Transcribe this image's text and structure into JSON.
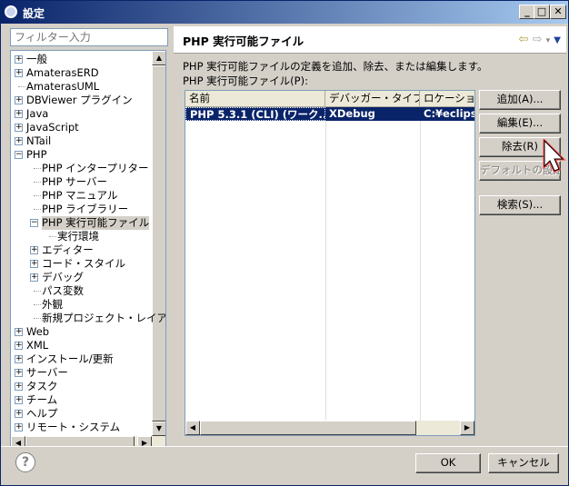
{
  "window": {
    "title": "設定"
  },
  "filter": {
    "placeholder": "フィルター入力"
  },
  "tree": {
    "items": [
      {
        "label": "一般",
        "level": 0,
        "expander": "+"
      },
      {
        "label": "AmaterasERD",
        "level": 0,
        "expander": "+"
      },
      {
        "label": "AmaterasUML",
        "level": 0,
        "expander": ""
      },
      {
        "label": "DBViewer プラグイン",
        "level": 0,
        "expander": "+"
      },
      {
        "label": "Java",
        "level": 0,
        "expander": "+"
      },
      {
        "label": "JavaScript",
        "level": 0,
        "expander": "+"
      },
      {
        "label": "NTail",
        "level": 0,
        "expander": "+"
      },
      {
        "label": "PHP",
        "level": 0,
        "expander": "-"
      },
      {
        "label": "PHP インタープリター",
        "level": 1,
        "expander": ""
      },
      {
        "label": "PHP サーバー",
        "level": 1,
        "expander": ""
      },
      {
        "label": "PHP マニュアル",
        "level": 1,
        "expander": ""
      },
      {
        "label": "PHP ライブラリー",
        "level": 1,
        "expander": ""
      },
      {
        "label": "PHP 実行可能ファイル",
        "level": 1,
        "expander": "-",
        "selected": true
      },
      {
        "label": "実行環境",
        "level": 2,
        "expander": ""
      },
      {
        "label": "エディター",
        "level": 1,
        "expander": "+"
      },
      {
        "label": "コード・スタイル",
        "level": 1,
        "expander": "+"
      },
      {
        "label": "デバッグ",
        "level": 1,
        "expander": "+"
      },
      {
        "label": "パス変数",
        "level": 1,
        "expander": ""
      },
      {
        "label": "外観",
        "level": 1,
        "expander": ""
      },
      {
        "label": "新規プロジェクト・レイア",
        "level": 1,
        "expander": ""
      },
      {
        "label": "Web",
        "level": 0,
        "expander": "+"
      },
      {
        "label": "XML",
        "level": 0,
        "expander": "+"
      },
      {
        "label": "インストール/更新",
        "level": 0,
        "expander": "+"
      },
      {
        "label": "サーバー",
        "level": 0,
        "expander": "+"
      },
      {
        "label": "タスク",
        "level": 0,
        "expander": "+"
      },
      {
        "label": "チーム",
        "level": 0,
        "expander": "+"
      },
      {
        "label": "ヘルプ",
        "level": 0,
        "expander": "+"
      },
      {
        "label": "リモート・システム",
        "level": 0,
        "expander": "+"
      }
    ]
  },
  "page": {
    "title": "PHP 実行可能ファイル",
    "description": "PHP 実行可能ファイルの定義を追加、除去、または編集します。",
    "list_label": "PHP 実行可能ファイル(P):"
  },
  "table": {
    "headers": [
      "名前",
      "デバッガー・タイプ",
      "ロケーション"
    ],
    "rows": [
      {
        "name": "PHP 5.3.1 (CLI) (ワーク...",
        "debugger": "XDebug",
        "location": "C:¥eclipse"
      }
    ]
  },
  "buttons": {
    "add": "追加(A)...",
    "edit": "編集(E)...",
    "remove": "除去(R)",
    "default": "デフォルトの設定",
    "search": "検索(S)..."
  },
  "footer": {
    "ok": "OK",
    "cancel": "キャンセル",
    "help": "?"
  },
  "colors": {
    "title_bar": "#0a246a",
    "selection": "#0a246a",
    "panel": "#d4d0c8"
  }
}
